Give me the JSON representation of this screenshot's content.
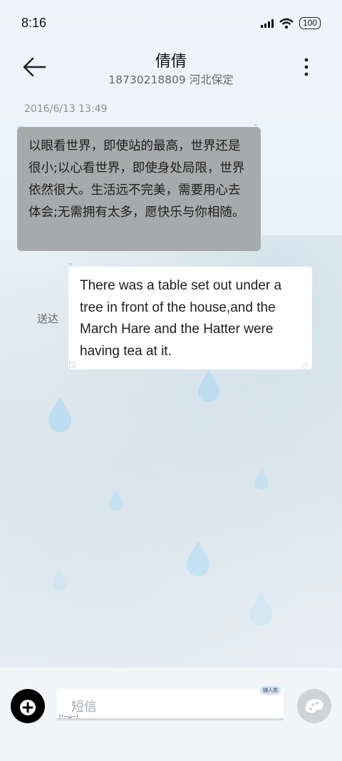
{
  "status_bar": {
    "time": "8:16",
    "battery": "100",
    "icons": [
      "signal-icon",
      "wifi-icon",
      "battery-icon"
    ]
  },
  "header": {
    "title": "倩倩",
    "subtitle": "18730218809 河北保定",
    "back_icon": "back-arrow-icon",
    "menu_icon": "more-vertical-icon"
  },
  "conversation": {
    "timestamp": "2016/6/13 13:49",
    "incoming": {
      "text": "以眼看世界，即使站的最高，世界还是很小;以心看世界，即使身处局限，世界依然很大。生活远不完美，需要用心去体会;无需拥有太多，愿快乐与你相随。"
    },
    "outgoing": {
      "text": "There was a table set out under a tree in front of the house,and the March Hare and the Hatter were having tea at it.",
      "status": "送达"
    }
  },
  "composer": {
    "placeholder": "短信",
    "tag": "嗨人类",
    "kaomoji": "(*~ω~)",
    "add_icon": "plus-icon",
    "send_icon": "theme-send-icon"
  },
  "colors": {
    "incoming_bubble": "#a7a9ab",
    "outgoing_bubble": "#ffffff",
    "raindrop": "#b9dbf0"
  }
}
